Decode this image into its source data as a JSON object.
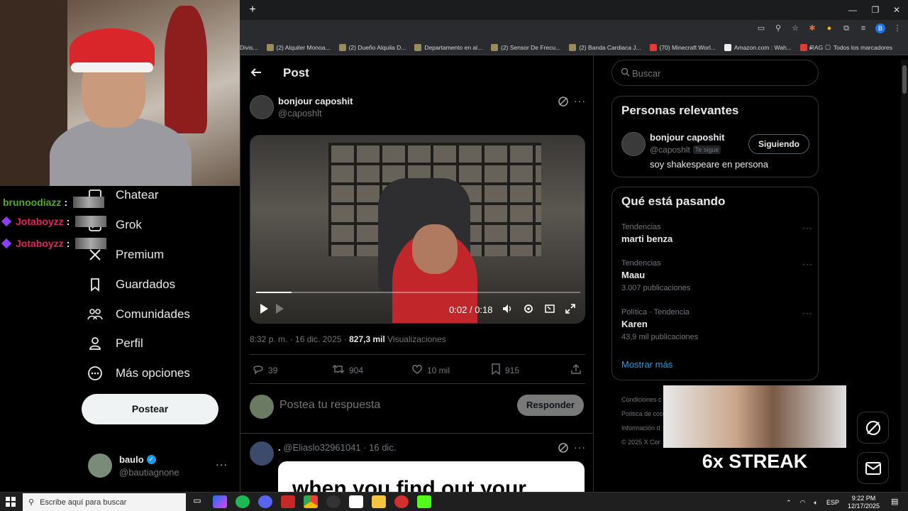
{
  "browser": {
    "new_tab": "+",
    "window_controls": [
      "—",
      "❐",
      "✕"
    ],
    "profile_initial": "B",
    "bookmarks": [
      {
        "label": "Divis..."
      },
      {
        "label": "(2) Alquiler Monoa..."
      },
      {
        "label": "(2) Dueño Alquila D..."
      },
      {
        "label": "Departamento en al..."
      },
      {
        "label": "(2) Sensor De Frecu..."
      },
      {
        "label": "(2) Banda Cardiaca J..."
      },
      {
        "label": "(70) Minecraft Worl..."
      },
      {
        "label": "Amazon.com : Wah..."
      },
      {
        "label": "RAG"
      }
    ],
    "bookmarks_overflow": "»",
    "all_bookmarks": "Todos los marcadores"
  },
  "chat": [
    {
      "user": "brunoodiazz",
      "color": "#4caf1b"
    },
    {
      "user": "Jotaboyzz",
      "color": "#e0245e"
    },
    {
      "user": "Jotaboyzz",
      "color": "#e0245e"
    }
  ],
  "nav": {
    "items": [
      {
        "label": "Chatear",
        "icon": "chat-icon"
      },
      {
        "label": "Grok",
        "icon": "grok-icon"
      },
      {
        "label": "Premium",
        "icon": "x-logo-icon"
      },
      {
        "label": "Guardados",
        "icon": "bookmark-icon"
      },
      {
        "label": "Comunidades",
        "icon": "communities-icon"
      },
      {
        "label": "Perfil",
        "icon": "profile-icon"
      },
      {
        "label": "Más opciones",
        "icon": "more-options-icon"
      }
    ],
    "post_button": "Postear",
    "account": {
      "name": "baulo",
      "handle": "@bautiagnone"
    }
  },
  "post": {
    "header_title": "Post",
    "author_name": "bonjour caposhit",
    "author_handle": "@caposhlt",
    "video": {
      "current_time": "0:02",
      "separator": "/",
      "duration": "0:18",
      "progress": 0.11
    },
    "timestamp": "8:32 p. m. · 16 dic. 2025 ·",
    "views_count": "827,3 mil",
    "views_label": "Visualizaciones",
    "stats": {
      "replies": "39",
      "reposts": "904",
      "likes": "10 mil",
      "bookmarks": "915"
    },
    "reply_placeholder": "Postea tu respuesta",
    "reply_button": "Responder"
  },
  "next_tweet": {
    "name": ".",
    "handle_date": "@Eliaslo32961041 · 16 dic.",
    "image_text": "when you find out your"
  },
  "right": {
    "search_placeholder": "Buscar",
    "relevant": {
      "title": "Personas relevantes",
      "name": "bonjour caposhit",
      "handle": "@caposhlt",
      "follows_you": "Te sigue",
      "follow_button": "Siguiendo",
      "bio": "soy shakespeare en persona"
    },
    "trends": {
      "title": "Qué está pasando",
      "items": [
        {
          "context": "Tendencias",
          "name": "marti benza",
          "count": ""
        },
        {
          "context": "Tendencias",
          "name": "Maau",
          "count": "3.007 publicaciones"
        },
        {
          "context": "Política · Tendencia",
          "name": "Karen",
          "count": "43,9 mil publicaciones"
        }
      ],
      "show_more": "Mostrar más"
    },
    "footer_lines": [
      "Condiciones c",
      "Política de coo",
      "Información d",
      "© 2025 X Cor"
    ]
  },
  "overlay": {
    "streak_text": "6x STREAK"
  },
  "taskbar": {
    "search_placeholder": "Escribe aquí para buscar",
    "lang": "ESP",
    "time": "9:22 PM",
    "date": "12/17/2025"
  }
}
